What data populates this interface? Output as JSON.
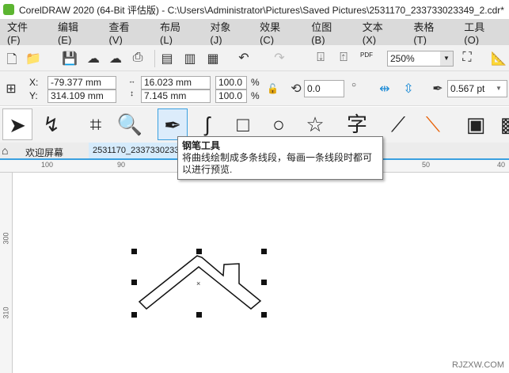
{
  "title": "CorelDRAW 2020 (64-Bit 评估版) - C:\\Users\\Administrator\\Pictures\\Saved Pictures\\2531170_233733023349_2.cdr*",
  "menu": [
    "文件(F)",
    "编辑(E)",
    "查看(V)",
    "布局(L)",
    "对象(J)",
    "效果(C)",
    "位图(B)",
    "文本(X)",
    "表格(T)",
    "工具(O)"
  ],
  "toolbar": {
    "zoom": "250%",
    "pdf": "PDF"
  },
  "props": {
    "x_label": "X:",
    "y_label": "Y:",
    "x": "-79.377 mm",
    "y": "314.109 mm",
    "w": "16.023 mm",
    "h": "7.145 mm",
    "sx": "100.0",
    "sy": "100.0",
    "pct": "%",
    "angle": "0.0",
    "outline": "0.567 pt"
  },
  "tabs": {
    "welcome": "欢迎屏幕",
    "doc": "2531170_233733023349_2"
  },
  "ruler": {
    "top": [
      "100",
      "90",
      "50",
      "40"
    ],
    "left": [
      "300",
      "310"
    ]
  },
  "tooltip": {
    "title": "钢笔工具",
    "body": "将曲线绘制成多条线段，每画一条线段时都可以进行预览."
  },
  "watermark": "RJZXW.COM",
  "colors": {
    "accent": "#3aa0e0",
    "node": "#e8630a"
  }
}
